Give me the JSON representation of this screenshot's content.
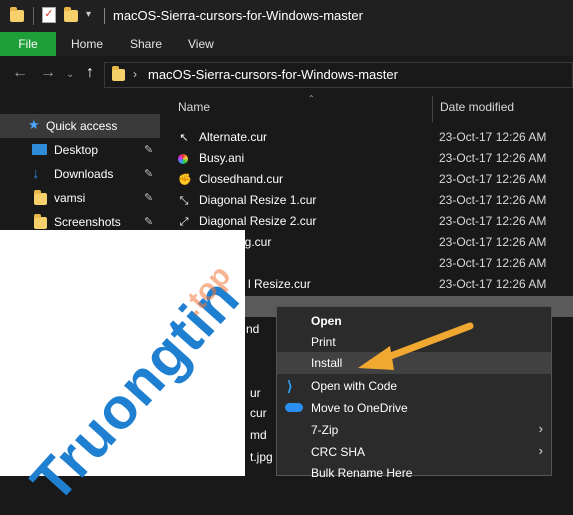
{
  "window": {
    "title": "macOS-Sierra-cursors-for-Windows-master"
  },
  "ribbon": {
    "tabs": [
      "File",
      "Home",
      "Share",
      "View"
    ]
  },
  "address": {
    "path": "macOS-Sierra-cursors-for-Windows-master"
  },
  "nav": {
    "quick_access": "Quick access",
    "items": [
      {
        "label": "Desktop",
        "icon": "desktop-icon"
      },
      {
        "label": "Downloads",
        "icon": "download-icon"
      },
      {
        "label": "vamsi",
        "icon": "folder-icon"
      },
      {
        "label": "Screenshots",
        "icon": "folder-icon"
      }
    ]
  },
  "columns": {
    "name": "Name",
    "date": "Date modified"
  },
  "files": [
    {
      "name": "Alternate.cur",
      "date": "23-Oct-17 12:26 AM"
    },
    {
      "name": "Busy.ani",
      "date": "23-Oct-17 12:26 AM"
    },
    {
      "name": "Closedhand.cur",
      "date": "23-Oct-17 12:26 AM"
    },
    {
      "name": "Diagonal Resize 1.cur",
      "date": "23-Oct-17 12:26 AM"
    },
    {
      "name": "Diagonal Resize 2.cur",
      "date": "23-Oct-17 12:26 AM"
    },
    {
      "name": "ng.cur",
      "date": "23-Oct-17 12:26 AM"
    },
    {
      "name": "",
      "date": "23-Oct-17 12:26 AM"
    },
    {
      "name": "l Resize.cur",
      "date": "23-Oct-17 12:26 AM"
    }
  ],
  "background_fragments": [
    "nd",
    "ur",
    "cur",
    "md",
    "t.jpg"
  ],
  "context_menu": [
    {
      "label": "Open",
      "bold": true,
      "submenu": false
    },
    {
      "label": "Print",
      "bold": false,
      "submenu": false
    },
    {
      "label": "Install",
      "bold": false,
      "submenu": false,
      "highlighted": true
    },
    {
      "label": "Open with Code",
      "bold": false,
      "submenu": false,
      "icon": "vscode-icon"
    },
    {
      "label": "Move to OneDrive",
      "bold": false,
      "submenu": false,
      "icon": "onedrive-icon"
    },
    {
      "label": "7-Zip",
      "bold": false,
      "submenu": true
    },
    {
      "label": "CRC SHA",
      "bold": false,
      "submenu": true
    },
    {
      "label": "Bulk Rename Here",
      "bold": false,
      "submenu": false
    }
  ],
  "watermark": {
    "text": "Truongtin",
    "suffix": ".top"
  },
  "colors": {
    "accent_file_tab": "#1e9e38",
    "arrow": "#f0a830",
    "watermark": "#1f7fd0"
  }
}
